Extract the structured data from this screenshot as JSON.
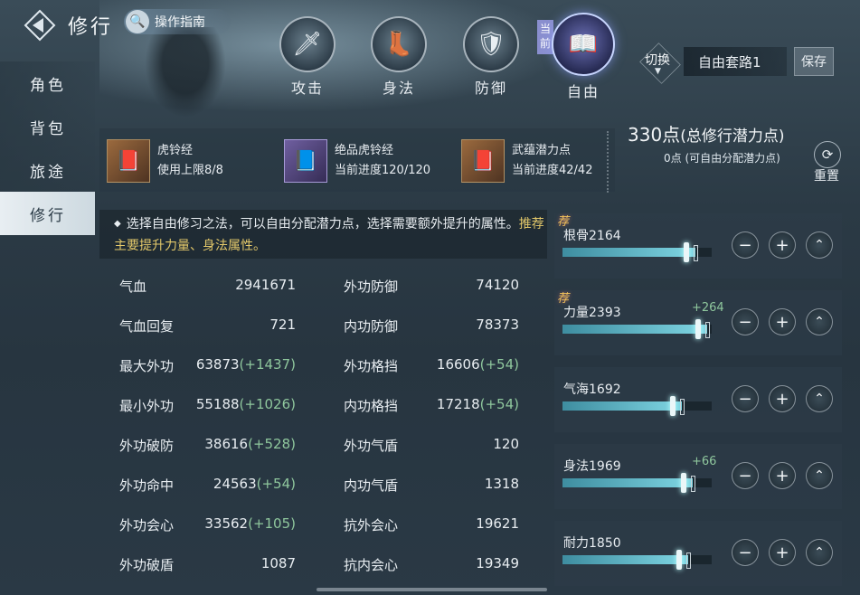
{
  "header": {
    "title": "修行",
    "guide_label": "操作指南"
  },
  "tabs": [
    {
      "label": "攻击",
      "icon": "sword-icon"
    },
    {
      "label": "身法",
      "icon": "boot-icon"
    },
    {
      "label": "防御",
      "icon": "shield-icon"
    },
    {
      "label": "自由",
      "icon": "book-icon",
      "active": true
    }
  ],
  "current_tag": "当前",
  "preset": {
    "switch_label": "切换",
    "name": "自由套路1",
    "save_label": "保存"
  },
  "sidebar": {
    "items": [
      "角色",
      "背包",
      "旅途",
      "修行"
    ],
    "active": "修行"
  },
  "items": [
    {
      "name": "虎铃经",
      "desc": "使用上限8/8"
    },
    {
      "name": "绝品虎铃经",
      "desc": "当前进度120/120"
    },
    {
      "name": "武蕴潜力点",
      "desc": "当前进度42/42"
    }
  ],
  "points": {
    "total_num": "330点",
    "total_label": "(总修行潜力点)",
    "free": "0点 (可自由分配潜力点)",
    "reset_label": "重置"
  },
  "notice": {
    "text": "选择自由修习之法，可以自由分配潜力点，选择需要额外提升的属性。",
    "highlight": "推荐主要提升力量、身法属性。"
  },
  "stats_left": [
    {
      "label": "气血",
      "value": "2941671",
      "bonus": ""
    },
    {
      "label": "气血回复",
      "value": "721",
      "bonus": ""
    },
    {
      "label": "最大外功",
      "value": "63873",
      "bonus": "(+1437)"
    },
    {
      "label": "最小外功",
      "value": "55188",
      "bonus": "(+1026)"
    },
    {
      "label": "外功破防",
      "value": "38616",
      "bonus": "(+528)"
    },
    {
      "label": "外功命中",
      "value": "24563",
      "bonus": "(+54)"
    },
    {
      "label": "外功会心",
      "value": "33562",
      "bonus": "(+105)"
    },
    {
      "label": "外功破盾",
      "value": "1087",
      "bonus": ""
    }
  ],
  "stats_right": [
    {
      "label": "外功防御",
      "value": "74120",
      "bonus": ""
    },
    {
      "label": "内功防御",
      "value": "78373",
      "bonus": ""
    },
    {
      "label": "外功格挡",
      "value": "16606",
      "bonus": "(+54)"
    },
    {
      "label": "内功格挡",
      "value": "17218",
      "bonus": "(+54)"
    },
    {
      "label": "外功气盾",
      "value": "120",
      "bonus": ""
    },
    {
      "label": "内功气盾",
      "value": "1318",
      "bonus": ""
    },
    {
      "label": "抗外会心",
      "value": "19621",
      "bonus": ""
    },
    {
      "label": "抗内会心",
      "value": "19349",
      "bonus": ""
    }
  ],
  "attributes": [
    {
      "name": "根骨",
      "value": "2164",
      "bonus": "",
      "recommended": true,
      "fill": 0.89
    },
    {
      "name": "力量",
      "value": "2393",
      "bonus": "+264",
      "recommended": true,
      "fill": 0.97
    },
    {
      "name": "气海",
      "value": "1692",
      "bonus": "",
      "recommended": false,
      "fill": 0.8
    },
    {
      "name": "身法",
      "value": "1969",
      "bonus": "+66",
      "recommended": false,
      "fill": 0.87
    },
    {
      "name": "耐力",
      "value": "1850",
      "bonus": "",
      "recommended": false,
      "fill": 0.84
    }
  ],
  "rec_tag": "荐",
  "controls": {
    "minus": "−",
    "plus": "+",
    "max": "⌃"
  }
}
